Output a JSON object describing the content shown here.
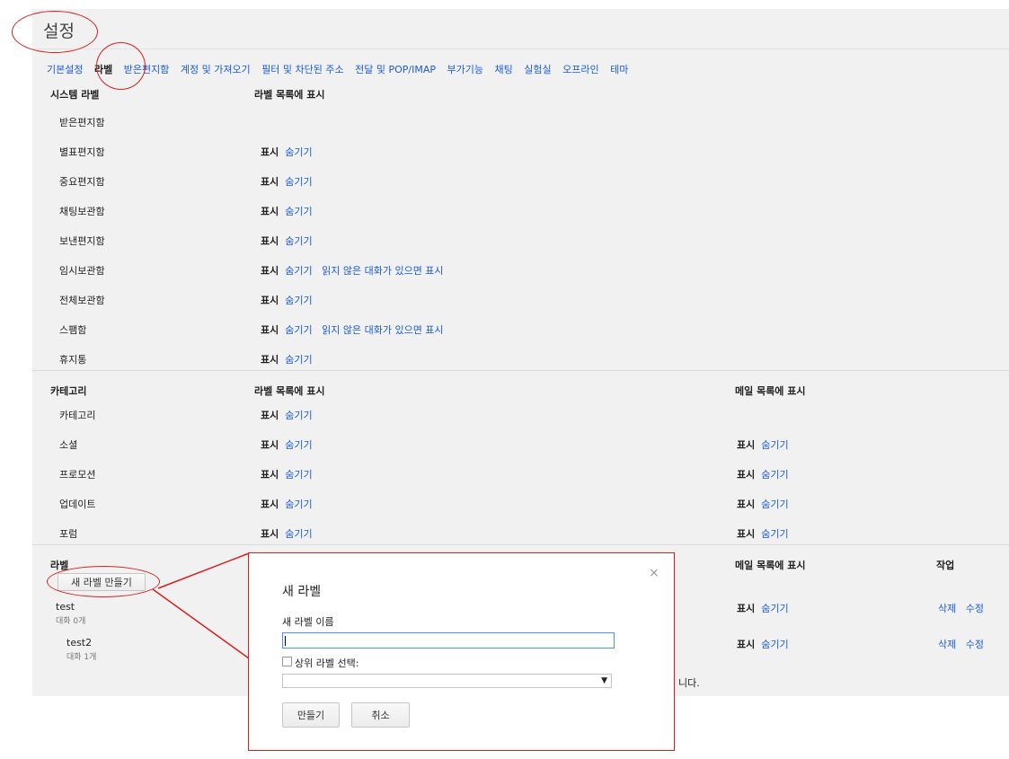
{
  "page": {
    "title": "설정"
  },
  "tabs": [
    {
      "label": "기본설정",
      "active": false
    },
    {
      "label": "라벨",
      "active": true
    },
    {
      "label": "받은편지함",
      "active": false
    },
    {
      "label": "계정 및 가져오기",
      "active": false
    },
    {
      "label": "필터 및 차단된 주소",
      "active": false
    },
    {
      "label": "전달 및 POP/IMAP",
      "active": false
    },
    {
      "label": "부가기능",
      "active": false
    },
    {
      "label": "채팅",
      "active": false
    },
    {
      "label": "실험실",
      "active": false
    },
    {
      "label": "오프라인",
      "active": false
    },
    {
      "label": "테마",
      "active": false
    }
  ],
  "system": {
    "header": "시스템 라벨",
    "col_header": "라벨 목록에 표시",
    "rows": [
      {
        "name": "받은편지함",
        "show": "",
        "hide": "",
        "extra": ""
      },
      {
        "name": "별표편지함",
        "show": "표시",
        "hide": "숨기기",
        "extra": ""
      },
      {
        "name": "중요편지함",
        "show": "표시",
        "hide": "숨기기",
        "extra": ""
      },
      {
        "name": "채팅보관함",
        "show": "표시",
        "hide": "숨기기",
        "extra": ""
      },
      {
        "name": "보낸편지함",
        "show": "표시",
        "hide": "숨기기",
        "extra": ""
      },
      {
        "name": "임시보관함",
        "show": "표시",
        "hide": "숨기기",
        "extra": "읽지 않은 대화가 있으면 표시"
      },
      {
        "name": "전체보관함",
        "show": "표시",
        "hide": "숨기기",
        "extra": ""
      },
      {
        "name": "스팸함",
        "show": "표시",
        "hide": "숨기기",
        "extra": "읽지 않은 대화가 있으면 표시"
      },
      {
        "name": "휴지통",
        "show": "표시",
        "hide": "숨기기",
        "extra": ""
      }
    ]
  },
  "categories": {
    "header": "카테고리",
    "col_header": "라벨 목록에 표시",
    "col_header2": "메일 목록에 표시",
    "rows": [
      {
        "name": "카테고리",
        "show": "표시",
        "hide": "숨기기",
        "show2": "",
        "hide2": ""
      },
      {
        "name": "소셜",
        "show": "표시",
        "hide": "숨기기",
        "show2": "표시",
        "hide2": "숨기기"
      },
      {
        "name": "프로모션",
        "show": "표시",
        "hide": "숨기기",
        "show2": "표시",
        "hide2": "숨기기"
      },
      {
        "name": "업데이트",
        "show": "표시",
        "hide": "숨기기",
        "show2": "표시",
        "hide2": "숨기기"
      },
      {
        "name": "포럼",
        "show": "표시",
        "hide": "숨기기",
        "show2": "표시",
        "hide2": "숨기기"
      }
    ]
  },
  "labels": {
    "header": "라벨",
    "col_header2": "메일 목록에 표시",
    "col_header3": "작업",
    "new_button": "새 라벨 만들기",
    "rows": [
      {
        "name": "test",
        "count": "대화 0개",
        "show2": "표시",
        "hide2": "숨기기",
        "delete": "삭제",
        "edit": "수정"
      },
      {
        "name": "test2",
        "count": "대화 1개",
        "show2": "표시",
        "hide2": "숨기기",
        "delete": "삭제",
        "edit": "수정"
      }
    ],
    "behind_text": "니다."
  },
  "dialog": {
    "title": "새 라벨",
    "close": "×",
    "name_label": "새 라벨 이름",
    "name_value": "",
    "parent_label": "상위 라벨 선택:",
    "parent_checked": false,
    "parent_value": "",
    "create_button": "만들기",
    "cancel_button": "취소"
  },
  "colors": {
    "link": "#1a5bd8",
    "annotation": "#d62020"
  }
}
